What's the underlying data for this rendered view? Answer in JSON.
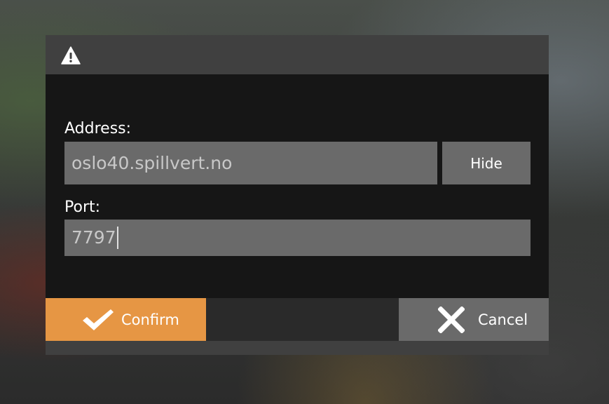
{
  "dialog": {
    "title_icon": "warning-icon",
    "address": {
      "label": "Address:",
      "value": "oslo40.spillvert.no",
      "toggle_label": "Hide"
    },
    "port": {
      "label": "Port:",
      "value": "7797"
    },
    "buttons": {
      "confirm": {
        "label": "Confirm",
        "icon": "checkmark-icon"
      },
      "cancel": {
        "label": "Cancel",
        "icon": "close-icon"
      }
    }
  },
  "colors": {
    "accent": "#e69644",
    "panel": "#161616",
    "titlebar": "#404040",
    "input_bg": "#6a6a6a"
  }
}
